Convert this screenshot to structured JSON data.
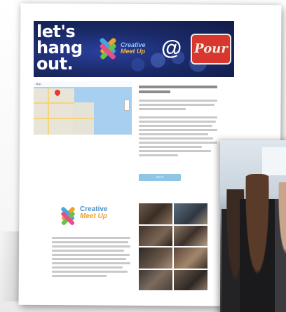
{
  "banner": {
    "line1": "let's",
    "line2": "hang",
    "line3": "out.",
    "logo_line1": "Creative",
    "logo_line2": "Meet Up",
    "at_sign": "@",
    "venue": "Pour"
  },
  "map": {
    "topbar": "Map"
  },
  "cta": {
    "label": "RSVP"
  },
  "meetup_logo": {
    "line1": "Creative",
    "line2": "Meet Up"
  },
  "colors": {
    "banner_navy": "#1b2b6a",
    "pour_red": "#d7372f",
    "logo_blue": "#4a90c9",
    "logo_orange": "#f0a030",
    "cta_blue": "#8fc6e6"
  },
  "icons": [
    "map-pin-icon",
    "meetup-logo-icon"
  ]
}
